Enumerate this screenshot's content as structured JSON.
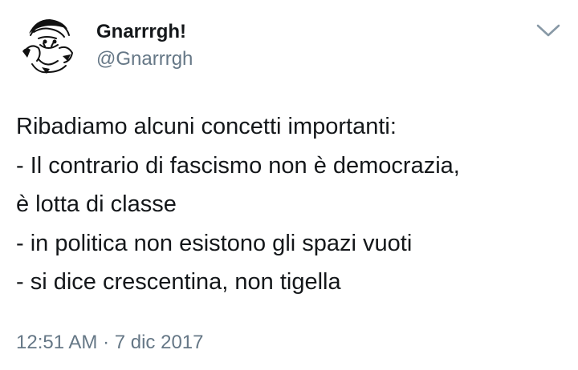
{
  "tweet": {
    "author": {
      "display_name": "Gnarrrgh!",
      "handle": "@Gnarrrgh",
      "avatar_icon": "ink-sketch-avatar"
    },
    "menu_icon": "chevron-down-icon",
    "text_lines": [
      "Ribadiamo alcuni concetti importanti:",
      "- Il contrario di fascismo non è democrazia,",
      "è lotta di classe",
      "- in politica non esistono gli spazi vuoti",
      "- si dice crescentina, non tigella"
    ],
    "timestamp": "12:51 AM · 7 dic 2017"
  },
  "colors": {
    "text": "#14171a",
    "secondary": "#657786",
    "background": "#ffffff"
  }
}
